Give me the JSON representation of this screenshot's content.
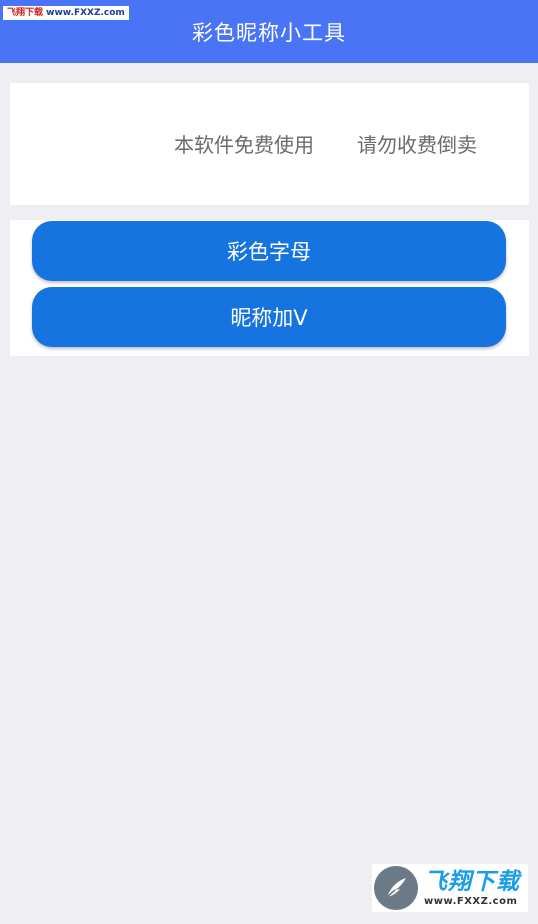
{
  "app": {
    "title": "彩色昵称小工具"
  },
  "watermark_top": {
    "label": "飞翔下载",
    "site": "www.FXXZ.com"
  },
  "notice": {
    "text1": "本软件免费使用",
    "text2": "请勿收费倒卖"
  },
  "actions": [
    {
      "label": "彩色字母"
    },
    {
      "label": "昵称加V"
    }
  ],
  "watermark_bottom": {
    "title": "飞翔下载",
    "url": "www.FXXZ.com"
  },
  "colors": {
    "header_bg": "#4a74f6",
    "button_bg": "#1574e0",
    "page_bg": "#efeef3"
  }
}
